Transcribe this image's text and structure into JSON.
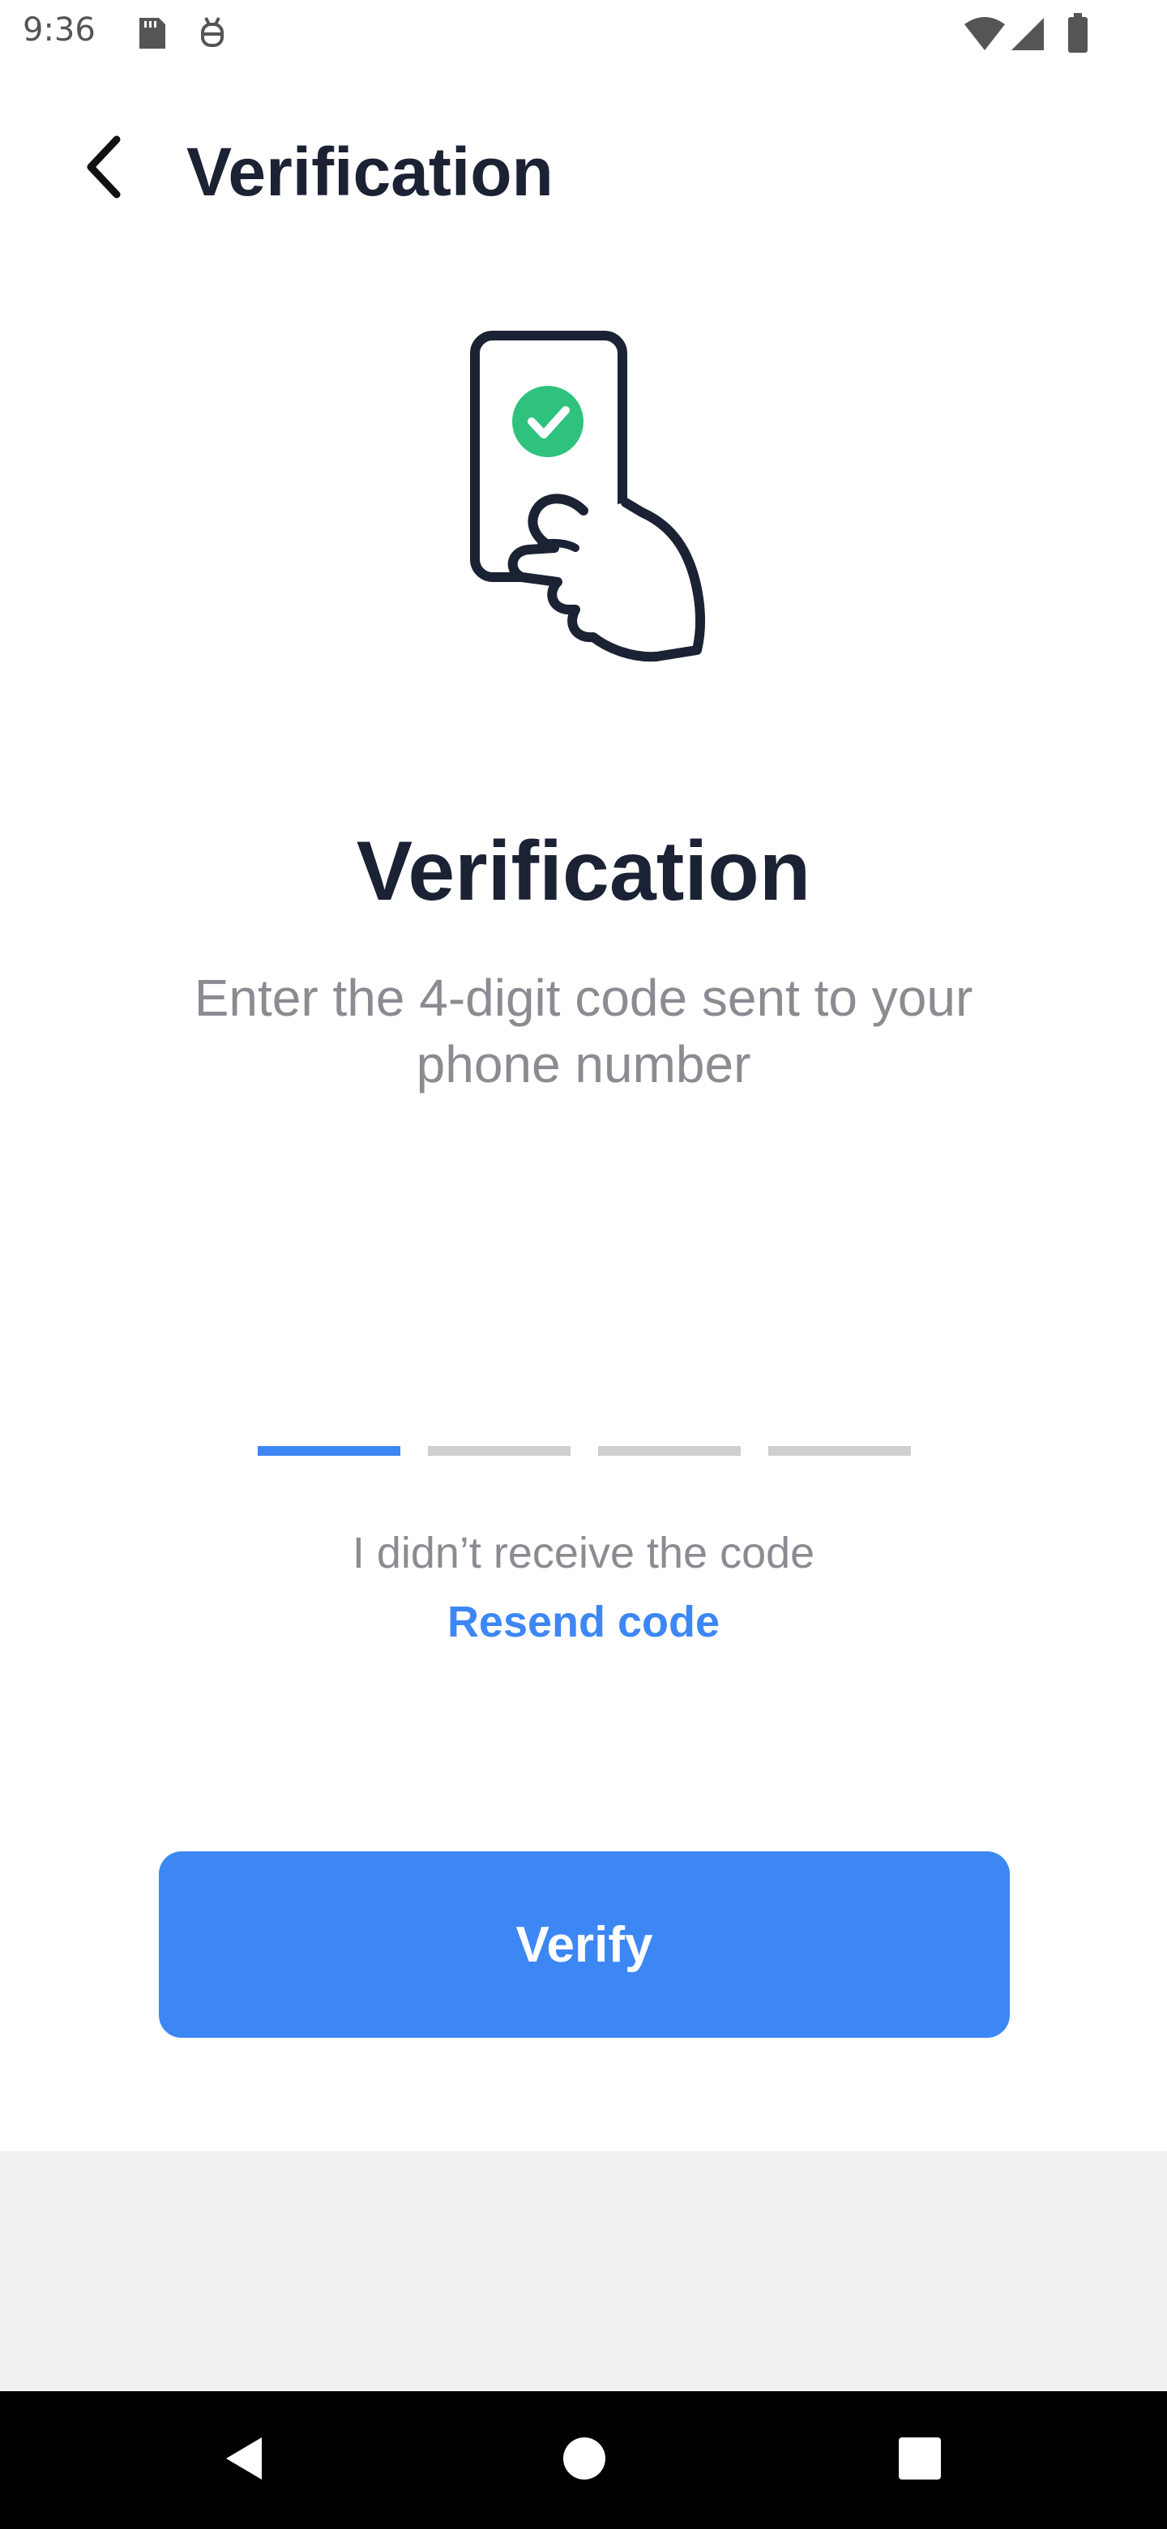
{
  "status_bar": {
    "time": "9:36",
    "icons": [
      "sd-card-icon",
      "debug-icon",
      "wifi-icon",
      "signal-icon",
      "battery-icon"
    ]
  },
  "header": {
    "back_icon": "chevron-left-icon",
    "title": "Verification"
  },
  "illustration": {
    "icon": "phone-hand-check-icon",
    "accent_color": "#2ec27e"
  },
  "main": {
    "title": "Verification",
    "subtitle": "Enter the 4-digit code sent to your phone number"
  },
  "code_input": {
    "digits": [
      "",
      "",
      "",
      ""
    ],
    "active_index": 0,
    "active_color": "#3d87f5",
    "inactive_color": "#cfcfcf"
  },
  "resend": {
    "prompt": "I didn’t receive the code",
    "link_label": "Resend code"
  },
  "actions": {
    "verify_label": "Verify",
    "primary_color": "#3d87f5"
  },
  "nav": {
    "back": "nav-back-icon",
    "home": "nav-home-icon",
    "recents": "nav-recents-icon"
  }
}
